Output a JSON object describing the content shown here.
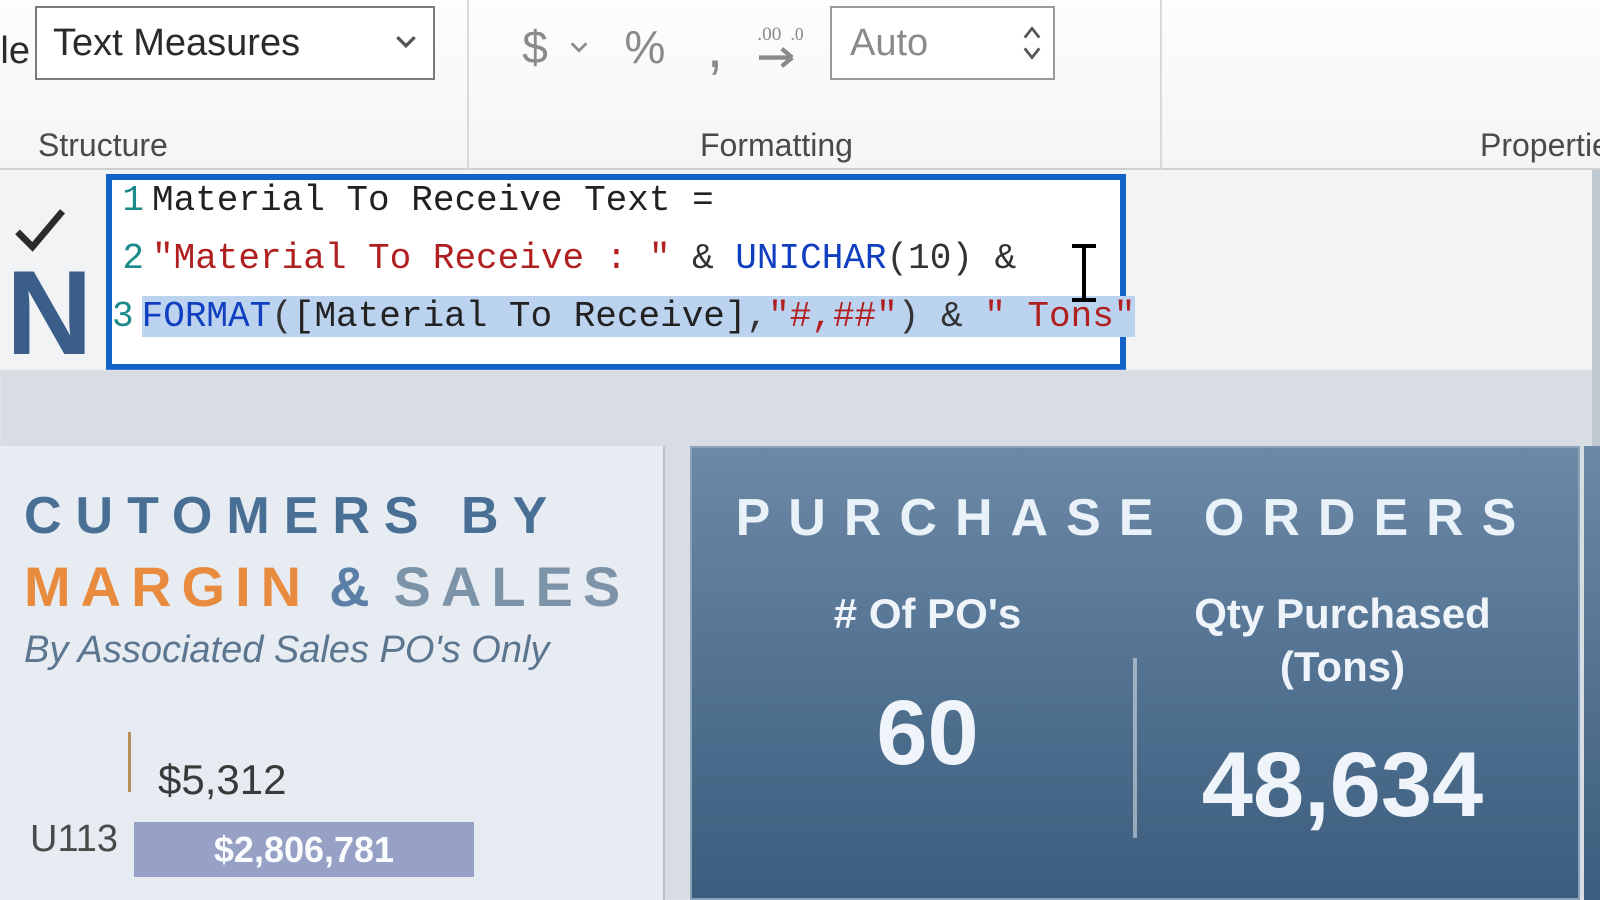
{
  "ribbon": {
    "home_table_fragment": "le",
    "table_select_value": "Text Measures",
    "group_structure": "Structure",
    "group_formatting": "Formatting",
    "group_properties": "Propertie",
    "auto_value": "Auto"
  },
  "formula": {
    "line_numbers": [
      "1",
      "2",
      "3"
    ],
    "line1": {
      "measure_name": "Material To Receive Text",
      "eq": " ="
    },
    "line2": {
      "str": "\"Material To Receive : \"",
      "amp1": " & ",
      "fn": "UNICHAR",
      "open": "(",
      "arg": "10",
      "close": ")",
      "amp2": " &"
    },
    "line3": {
      "fn": "FORMAT",
      "open": "(",
      "ref": "[Material To Receive]",
      "comma": ",",
      "fmt": "\"#,##\"",
      "close": ")",
      "amp": " & ",
      "tail": "\" Tons\""
    }
  },
  "canvas": {
    "big_letter": "N",
    "left_card": {
      "title_customers_by": "CUTOMERS BY",
      "title_margin": "MARGIN",
      "title_amp": "&",
      "title_sales": "SALES",
      "subtitle": "By Associated  Sales PO's Only",
      "row_label": "U113",
      "value_small": "$5,312",
      "value_bar": "$2,806,781"
    },
    "right_card": {
      "title": "PURCHASE ORDERS",
      "col1_header": "# Of PO's",
      "col1_value": "60",
      "col2_header_l1": "Qty Purchased",
      "col2_header_l2": "(Tons)",
      "col2_value": "48,634"
    }
  }
}
